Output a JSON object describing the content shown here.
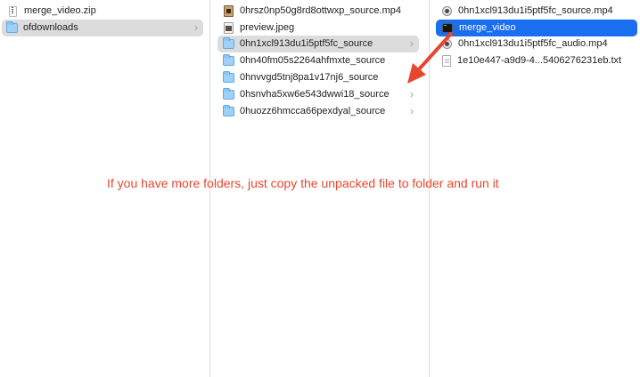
{
  "columns": [
    {
      "items": [
        {
          "label": "merge_video.zip",
          "icon": "zip-archive-icon",
          "selected": "none",
          "chevron": false
        },
        {
          "label": "ofdownloads",
          "icon": "folder-icon",
          "selected": "gray",
          "chevron": true
        }
      ]
    },
    {
      "items": [
        {
          "label": "0hrsz0np50g8rd8ottwxp_source.mp4",
          "icon": "video-file-icon",
          "selected": "none",
          "chevron": false
        },
        {
          "label": "preview.jpeg",
          "icon": "image-file-icon",
          "selected": "none",
          "chevron": false
        },
        {
          "label": "0hn1xcl913du1i5ptf5fc_source",
          "icon": "folder-icon",
          "selected": "gray",
          "chevron": true
        },
        {
          "label": "0hn40fm05s2264ahfmxte_source",
          "icon": "folder-icon",
          "selected": "none",
          "chevron": true
        },
        {
          "label": "0hnvvgd5tnj8pa1v17nj6_source",
          "icon": "folder-icon",
          "selected": "none",
          "chevron": true
        },
        {
          "label": "0hsnvha5xw6e543dwwi18_source",
          "icon": "folder-icon",
          "selected": "none",
          "chevron": true
        },
        {
          "label": "0huozz6hmcca66pexdyal_source",
          "icon": "folder-icon",
          "selected": "none",
          "chevron": true
        }
      ]
    },
    {
      "items": [
        {
          "label": "0hn1xcl913du1i5ptf5fc_source.mp4",
          "icon": "quicktime-file-icon",
          "selected": "none",
          "chevron": false
        },
        {
          "label": "merge_video",
          "icon": "executable-file-icon",
          "selected": "blue",
          "chevron": false
        },
        {
          "label": "0hn1xcl913du1i5ptf5fc_audio.mp4",
          "icon": "quicktime-file-icon",
          "selected": "none",
          "chevron": false
        },
        {
          "label": "1e10e447-a9d9-4...5406276231eb.txt",
          "icon": "text-file-icon",
          "selected": "none",
          "chevron": false
        }
      ]
    }
  ],
  "chevron_glyph": "›",
  "annotation": {
    "text": "If you have more folders, just copy the unpacked file to folder and run it",
    "color": "#e8462e"
  },
  "colors": {
    "selection_gray": "#dcdcdc",
    "selection_blue": "#1a6ef0",
    "folder_blue": "#9fd1f6"
  }
}
